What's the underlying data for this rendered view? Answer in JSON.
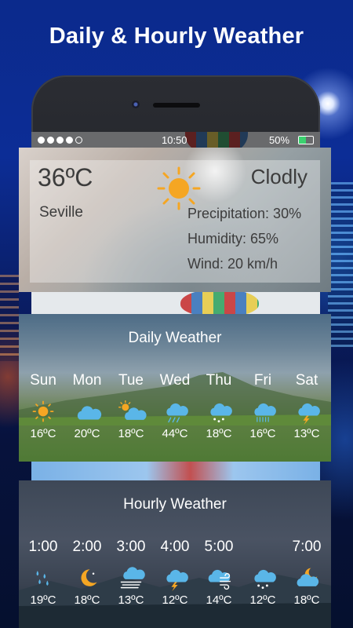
{
  "headline": "Daily & Hourly Weather",
  "status_bar": {
    "time": "10:50",
    "battery": "50%",
    "battery_level": 0.5,
    "signal_dots_filled": 4,
    "signal_dots_total": 5
  },
  "current": {
    "temperature": "36ºC",
    "city": "Seville",
    "condition": "Clodly",
    "icon": "sun-icon",
    "precipitation": "Precipitation: 30%",
    "humidity": "Humidity: 65%",
    "wind": "Wind: 20 km/h"
  },
  "daily": {
    "title": "Daily Weather",
    "days": [
      {
        "day": "Sun",
        "temp": "16ºC",
        "icon": "sun-icon"
      },
      {
        "day": "Mon",
        "temp": "20ºC",
        "icon": "cloud-icon"
      },
      {
        "day": "Tue",
        "temp": "18ºC",
        "icon": "partly-cloudy-icon"
      },
      {
        "day": "Wed",
        "temp": "44ºC",
        "icon": "rain-icon"
      },
      {
        "day": "Thu",
        "temp": "18ºC",
        "icon": "snow-icon"
      },
      {
        "day": "Fri",
        "temp": "16ºC",
        "icon": "heavy-rain-icon"
      },
      {
        "day": "Sat",
        "temp": "13ºC",
        "icon": "thunderstorm-icon"
      }
    ]
  },
  "hourly": {
    "title": "Hourly Weather",
    "hours": [
      {
        "hour": "1:00",
        "temp": "19ºC",
        "icon": "raindrops-icon"
      },
      {
        "hour": "2:00",
        "temp": "18ºC",
        "icon": "moon-icon"
      },
      {
        "hour": "3:00",
        "temp": "13ºC",
        "icon": "fog-icon"
      },
      {
        "hour": "4:00",
        "temp": "12ºC",
        "icon": "thunderstorm-icon"
      },
      {
        "hour": "5:00",
        "temp": "14ºC",
        "icon": "wind-icon"
      },
      {
        "hour": "",
        "temp": "12ºC",
        "icon": "snow-icon"
      },
      {
        "hour": "7:00",
        "temp": "18ºC",
        "icon": "cloudy-night-icon"
      }
    ]
  },
  "colors": {
    "icon_blue": "#5ab6e8",
    "sun_orange": "#f5a623",
    "battery_green": "#3bd16f"
  }
}
